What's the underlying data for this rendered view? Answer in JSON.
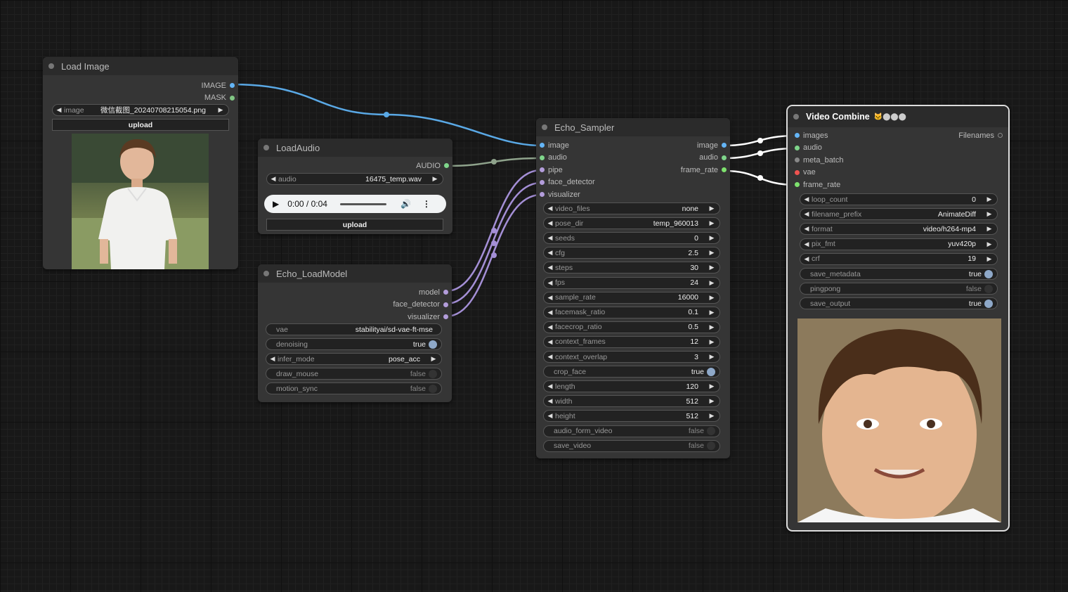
{
  "load_image": {
    "title": "Load Image",
    "outputs": [
      "IMAGE",
      "MASK"
    ],
    "image_widget": {
      "label": "image",
      "value": "微信截图_20240708215054.png"
    },
    "upload_label": "upload"
  },
  "load_audio": {
    "title": "LoadAudio",
    "output": "AUDIO",
    "audio_widget": {
      "label": "audio",
      "value": "16475_temp.wav"
    },
    "player_time": "0:00 / 0:04",
    "upload_label": "upload"
  },
  "load_model": {
    "title": "Echo_LoadModel",
    "outputs": [
      "model",
      "face_detector",
      "visualizer"
    ],
    "widgets": [
      {
        "label": "vae",
        "value": "stabilityai/sd-vae-ft-mse"
      },
      {
        "label": "denoising",
        "value": "true"
      },
      {
        "label": "infer_mode",
        "value": "pose_acc"
      },
      {
        "label": "draw_mouse",
        "value": "false"
      },
      {
        "label": "motion_sync",
        "value": "false"
      }
    ]
  },
  "sampler": {
    "title": "Echo_Sampler",
    "inputs": [
      "image",
      "audio",
      "pipe",
      "face_detector",
      "visualizer"
    ],
    "outputs": [
      "image",
      "audio",
      "frame_rate"
    ],
    "widgets": [
      {
        "label": "video_files",
        "value": "none"
      },
      {
        "label": "pose_dir",
        "value": "temp_960013"
      },
      {
        "label": "seeds",
        "value": "0"
      },
      {
        "label": "cfg",
        "value": "2.5"
      },
      {
        "label": "steps",
        "value": "30"
      },
      {
        "label": "fps",
        "value": "24"
      },
      {
        "label": "sample_rate",
        "value": "16000"
      },
      {
        "label": "facemask_ratio",
        "value": "0.1"
      },
      {
        "label": "facecrop_ratio",
        "value": "0.5"
      },
      {
        "label": "context_frames",
        "value": "12"
      },
      {
        "label": "context_overlap",
        "value": "3"
      },
      {
        "label": "crop_face",
        "value": "true"
      },
      {
        "label": "length",
        "value": "120"
      },
      {
        "label": "width",
        "value": "512"
      },
      {
        "label": "height",
        "value": "512"
      },
      {
        "label": "audio_form_video",
        "value": "false"
      },
      {
        "label": "save_video",
        "value": "false"
      }
    ]
  },
  "video_combine": {
    "title": "Video Combine",
    "inputs": [
      "images",
      "audio",
      "meta_batch",
      "vae",
      "frame_rate"
    ],
    "output": "Filenames",
    "widgets": [
      {
        "label": "loop_count",
        "value": "0"
      },
      {
        "label": "filename_prefix",
        "value": "AnimateDiff"
      },
      {
        "label": "format",
        "value": "video/h264-mp4"
      },
      {
        "label": "pix_fmt",
        "value": "yuv420p"
      },
      {
        "label": "crf",
        "value": "19"
      },
      {
        "label": "save_metadata",
        "value": "true"
      },
      {
        "label": "pingpong",
        "value": "false"
      },
      {
        "label": "save_output",
        "value": "true"
      }
    ]
  },
  "colors": {
    "image_link": "#5aa9e6",
    "audio_link": "#8fa38c",
    "purple_link": "#a48fd6",
    "white_link": "#ffffff"
  }
}
